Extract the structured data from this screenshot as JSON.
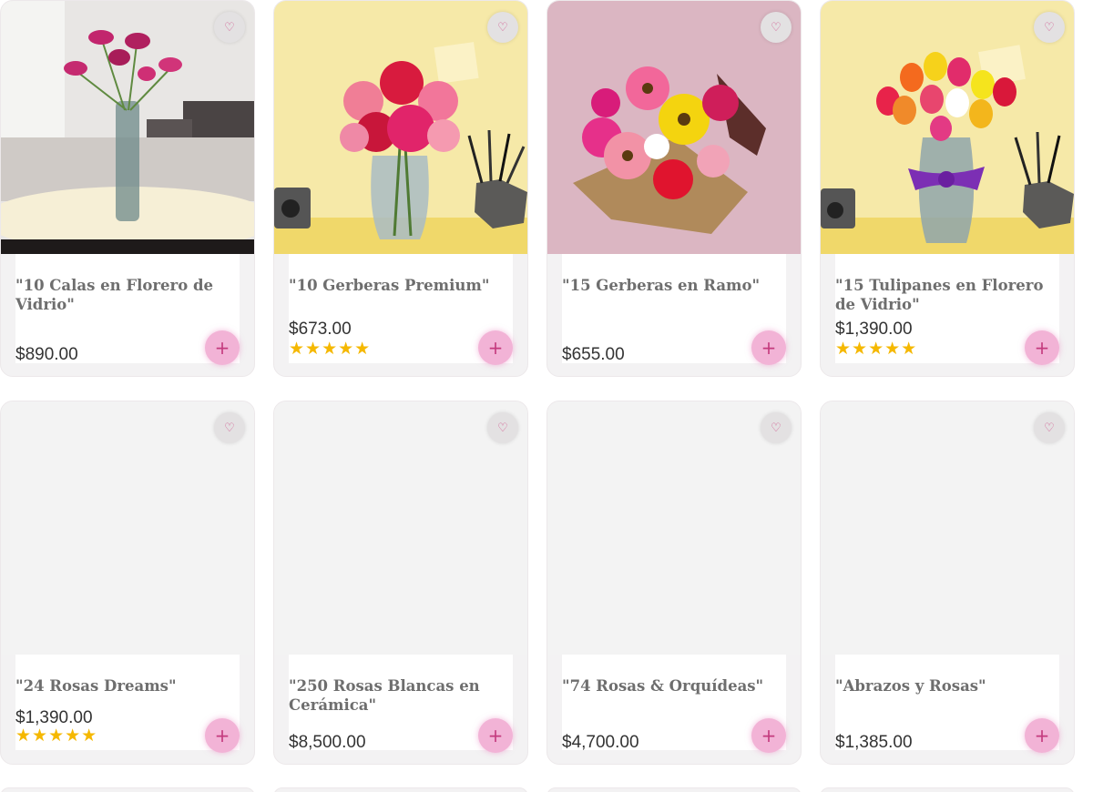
{
  "products": [
    {
      "title": "\"10 Calas en Florero de Vidrio\"",
      "price": "$890.00",
      "stars": "",
      "image_icon": "calla-lilies-vase-image"
    },
    {
      "title": "\"10 Gerberas Premium\"",
      "price": "$673.00",
      "stars": "★★★★★",
      "image_icon": "gerberas-vase-image"
    },
    {
      "title": "\"15 Gerberas en Ramo\"",
      "price": "$655.00",
      "stars": "",
      "image_icon": "gerbera-bouquet-image"
    },
    {
      "title": "\"15 Tulipanes en Florero de Vidrio\"",
      "price": "$1,390.00",
      "stars": "★★★★★",
      "image_icon": "tulips-vase-image"
    },
    {
      "title": "\"24 Rosas Dreams\"",
      "price": "$1,390.00",
      "stars": "★★★★★",
      "image_icon": "placeholder-image"
    },
    {
      "title": "\"250 Rosas Blancas en Cerámica\"",
      "price": "$8,500.00",
      "stars": "",
      "image_icon": "placeholder-image"
    },
    {
      "title": "\"74 Rosas & Orquídeas\"",
      "price": "$4,700.00",
      "stars": "",
      "image_icon": "placeholder-image"
    },
    {
      "title": "\"Abrazos y Rosas\"",
      "price": "$1,385.00",
      "stars": "",
      "image_icon": "placeholder-image"
    }
  ],
  "icons": {
    "favorite": "♡",
    "add": "+"
  },
  "colors": {
    "accent_pink": "#f2b3d6",
    "star_yellow": "#f5b800",
    "card_bg": "#f3f2f3"
  }
}
